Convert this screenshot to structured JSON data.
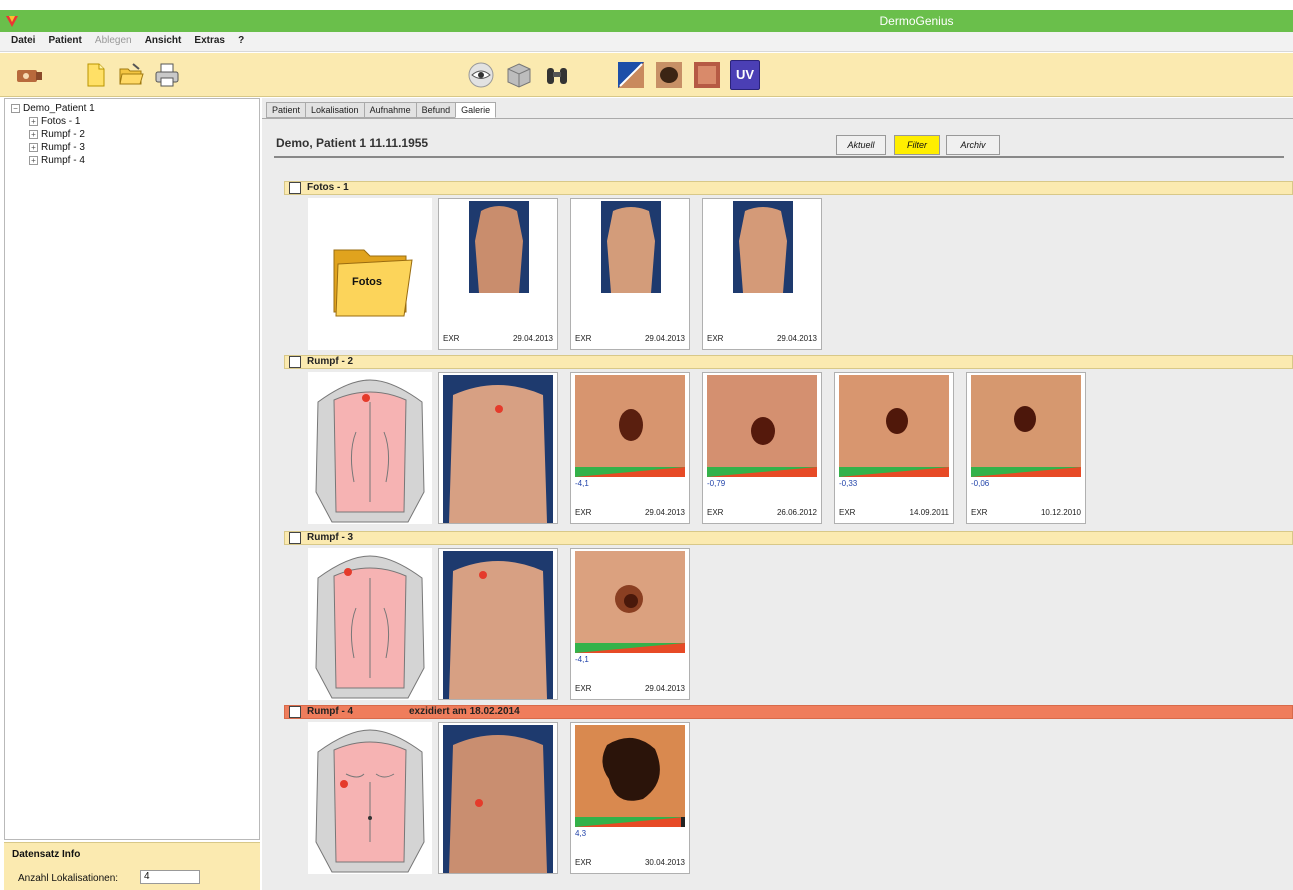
{
  "window": {
    "title": "DermoGenius"
  },
  "menu": [
    "Datei",
    "Patient",
    "Ablegen",
    "Ansicht",
    "Extras",
    "?"
  ],
  "toolbar": {
    "left_icons": [
      "camera-icon",
      "new-document-icon",
      "open-folder-icon",
      "print-icon"
    ],
    "center_icons": [
      "eye-icon",
      "cube-icon",
      "binoculars-icon"
    ],
    "right_icons": [
      "compare-icon",
      "lesion-icon",
      "skin-icon"
    ],
    "uv_label": "UV"
  },
  "tree": {
    "root": "Demo_Patient 1",
    "children": [
      "Fotos - 1",
      "Rumpf - 2",
      "Rumpf - 3",
      "Rumpf - 4"
    ]
  },
  "info": {
    "header": "Datensatz Info",
    "count_label": "Anzahl Lokalisationen:",
    "count_value": "4"
  },
  "tabs": [
    "Patient",
    "Lokalisation",
    "Aufnahme",
    "Befund",
    "Galerie"
  ],
  "active_tab": "Galerie",
  "patient_header": "Demo, Patient 1   11.11.1955",
  "filters": [
    "Aktuell",
    "Filter",
    "Archiv"
  ],
  "selected_filter": "Filter",
  "sections": [
    {
      "title": "Fotos - 1",
      "note": "",
      "alert": false,
      "folder_label": "Fotos",
      "thumbs": [
        {
          "device": "EXR",
          "date": "29.04.2013"
        },
        {
          "device": "EXR",
          "date": "29.04.2013"
        },
        {
          "device": "EXR",
          "date": "29.04.2013"
        }
      ]
    },
    {
      "title": "Rumpf - 2",
      "note": "",
      "alert": false,
      "thumbs": [
        {
          "device": "EXR",
          "date": "29.04.2013",
          "score": "-4,1"
        },
        {
          "device": "EXR",
          "date": "26.06.2012",
          "score": "-0,79"
        },
        {
          "device": "EXR",
          "date": "14.09.2011",
          "score": "-0,33"
        },
        {
          "device": "EXR",
          "date": "10.12.2010",
          "score": "-0,06"
        }
      ]
    },
    {
      "title": "Rumpf - 3",
      "note": "",
      "alert": false,
      "thumbs": [
        {
          "device": "EXR",
          "date": "29.04.2013",
          "score": "-4,1"
        }
      ]
    },
    {
      "title": "Rumpf - 4",
      "note": "exzidiert am 18.02.2014",
      "alert": true,
      "thumbs": [
        {
          "device": "EXR",
          "date": "30.04.2013",
          "score": "4,3"
        }
      ]
    }
  ],
  "colors": {
    "titlebar": "#6abf4b",
    "toolbar": "#fbeab0",
    "alert": "#ef7d5c",
    "filter_selected": "#ffee00",
    "skin": "#d59b79",
    "body_map_fill": "#f6b3b3"
  }
}
